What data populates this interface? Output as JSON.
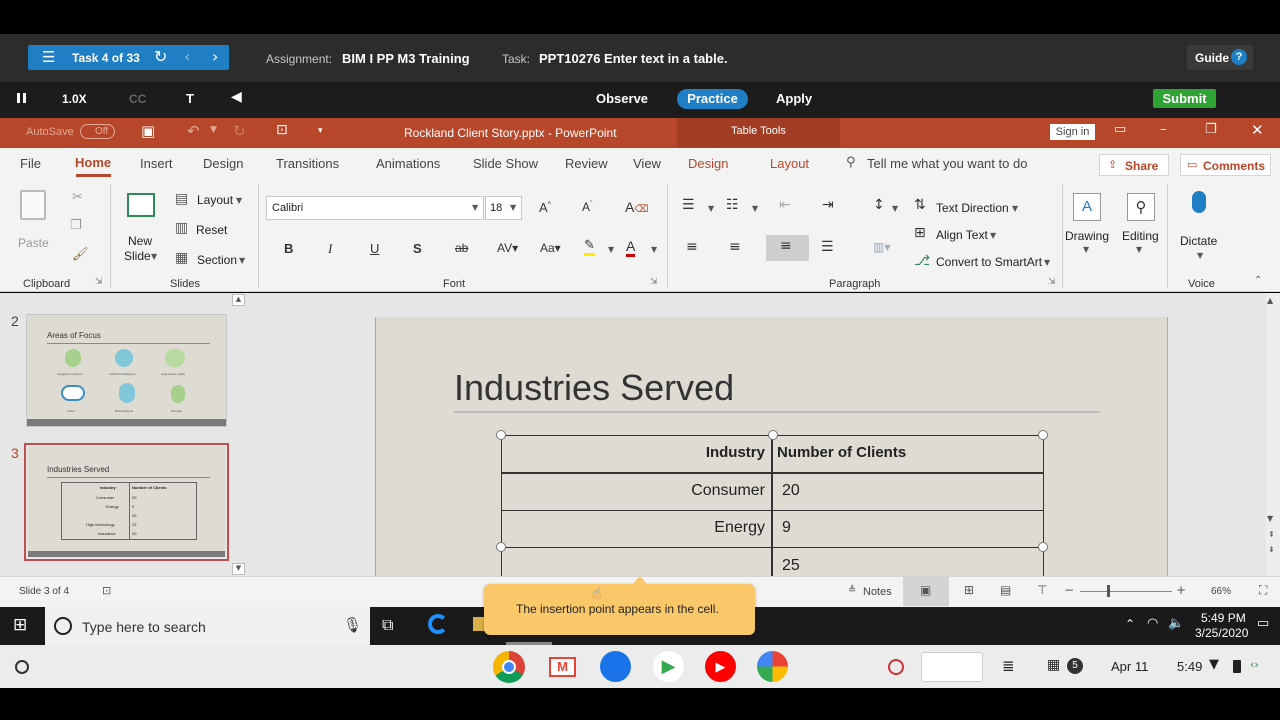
{
  "trainer": {
    "task_counter": "Task 4 of 33",
    "assignment_label": "Assignment:",
    "assignment_value": "BIM I PP M3 Training",
    "task_label": "Task:",
    "task_value": "PPT10276 Enter text in a table.",
    "guide": "Guide",
    "speed": "1.0X",
    "cc": "CC",
    "t": "T",
    "modes": [
      "Observe",
      "Practice",
      "Apply"
    ],
    "submit": "Submit",
    "active_mode": "Practice"
  },
  "titlebar": {
    "autosave": "AutoSave",
    "autosave_state": "Off",
    "filename": "Rockland Client Story.pptx - PowerPoint",
    "table_tools": "Table Tools",
    "sign_in": "Sign in"
  },
  "tabs": [
    "File",
    "Home",
    "Insert",
    "Design",
    "Transitions",
    "Animations",
    "Slide Show",
    "Review",
    "View"
  ],
  "context_tabs": [
    "Design",
    "Layout"
  ],
  "active_tab": "Home",
  "tell_me": "Tell me what you want to do",
  "share": "Share",
  "comments": "Comments",
  "ribbon": {
    "paste": "Paste",
    "clipboard": "Clipboard",
    "new_slide_1": "New",
    "new_slide_2": "Slide",
    "layout": "Layout",
    "reset": "Reset",
    "section": "Section",
    "slides": "Slides",
    "font_name": "Calibri",
    "font_size": "18",
    "font": "Font",
    "paragraph": "Paragraph",
    "text_direction": "Text Direction",
    "align_text": "Align Text",
    "convert_smartart": "Convert to SmartArt",
    "drawing": "Drawing",
    "editing": "Editing",
    "dictate": "Dictate",
    "voice": "Voice"
  },
  "thumbnails": [
    {
      "number": "2",
      "title": "Areas of Focus",
      "captions": [
        "Integrated systems",
        "Artificial Intelligence",
        "Augmented reality",
        "Cloud",
        "Data analysis",
        "Security"
      ]
    },
    {
      "number": "3",
      "title": "Industries Served",
      "header": [
        "Industry",
        "Number of Clients"
      ],
      "rows": [
        [
          "Consumer",
          "20"
        ],
        [
          "Energy",
          "9"
        ],
        [
          "",
          "25"
        ],
        [
          "High technology",
          "23"
        ],
        [
          "Insurance",
          "20"
        ]
      ]
    }
  ],
  "slide": {
    "title": "Industries Served",
    "table": {
      "header": [
        "Industry",
        "Number of Clients"
      ],
      "rows": [
        [
          "Consumer",
          "20"
        ],
        [
          "Energy",
          "9"
        ],
        [
          "",
          "25"
        ]
      ]
    }
  },
  "status": {
    "slide_of": "Slide 3 of 4",
    "notes": "Notes",
    "zoom": "66%"
  },
  "tooltip": "The insertion point appears in the cell.",
  "windows": {
    "search_placeholder": "Type here to search",
    "time": "5:49 PM",
    "date": "3/25/2020"
  },
  "chromeos": {
    "date": "Apr 11",
    "time": "5:49",
    "notif_count": "5"
  }
}
